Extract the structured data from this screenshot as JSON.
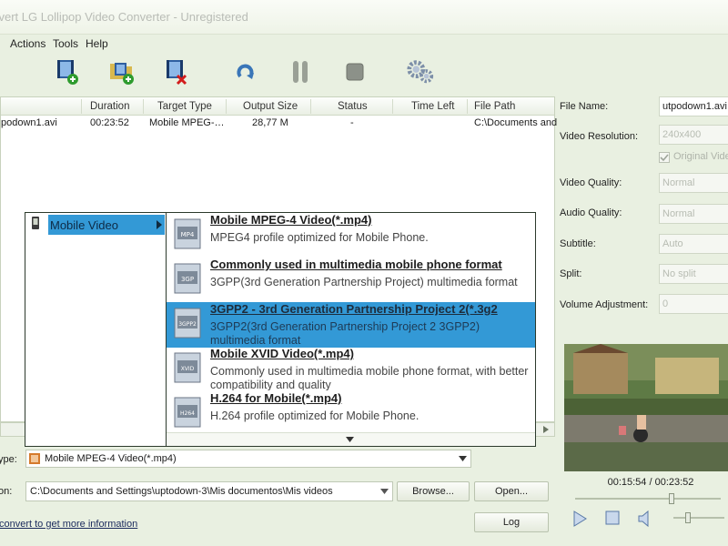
{
  "window": {
    "title": "onvert LG Lollipop Video Converter - Unregistered"
  },
  "menu": {
    "items": [
      "Actions",
      "Tools",
      "Help"
    ]
  },
  "toolbar": {
    "icons": [
      "add-video-icon",
      "add-folder-icon",
      "remove-video-icon",
      "refresh-icon",
      "pause-icon",
      "stop-icon",
      "settings-gears-icon"
    ]
  },
  "file_list": {
    "columns": [
      "Duration",
      "Target Type",
      "Output Size",
      "Status",
      "Time Left",
      "File Path"
    ],
    "rows": [
      {
        "name": "podown1.avi",
        "duration": "00:23:52",
        "target_type": "Mobile MPEG-…",
        "output_size": "28,77 M",
        "status": "-",
        "time_left": "",
        "file_path": "C:\\Documents and"
      }
    ]
  },
  "category_menu": {
    "label": "Mobile Video"
  },
  "formats": [
    {
      "icon": "mp4-file-icon",
      "title": "Mobile MPEG-4 Video(*.mp4)",
      "description": "MPEG4 profile optimized for Mobile Phone.",
      "selected": false
    },
    {
      "icon": "3gp-file-icon",
      "title": "Commonly used in multimedia mobile phone format",
      "description": "3GPP(3rd Generation Partnership Project) multimedia format",
      "selected": false
    },
    {
      "icon": "3gpp2-file-icon",
      "title": "3GPP2 - 3rd Generation Partnership Project 2(*.3g2",
      "description": "3GPP2(3rd Generation Partnership Project 2 3GPP2) multimedia format",
      "selected": true
    },
    {
      "icon": "xvid-file-icon",
      "title": "Mobile XVID Video(*.mp4)",
      "description": "Commonly used in multimedia mobile phone format, with better compatibility and quality",
      "selected": false
    },
    {
      "icon": "h264-file-icon",
      "title": "H.264 for Mobile(*.mp4)",
      "description": "H.264 profile optimized for Mobile Phone.",
      "selected": false
    }
  ],
  "properties": {
    "file_name_label": "File Name:",
    "file_name": "utpodown1.avi",
    "resolution_label": "Video Resolution:",
    "resolution": "240x400",
    "original_label": "Original Vide",
    "quality_label": "Video Quality:",
    "quality": "Normal",
    "audio_label": "Audio Quality:",
    "audio": "Normal",
    "subtitle_label": "Subtitle:",
    "subtitle": "Auto",
    "split_label": "Split:",
    "split": "No split",
    "volume_label": "Volume Adjustment:",
    "volume": "0"
  },
  "output": {
    "type_label": "ype:",
    "type_value": "Mobile MPEG-4 Video(*.mp4)",
    "path_label": "on:",
    "path_value": "C:\\Documents and Settings\\uptodown-3\\Mis documentos\\Mis videos",
    "browse": "Browse...",
    "open": "Open...",
    "log": "Log",
    "register_link": "convert to get more information"
  },
  "player": {
    "timecode": "00:15:54 / 00:23:52",
    "position": 0.67,
    "volume": 0.25
  },
  "colors": {
    "selection": "#3399d6",
    "background": "#e9f0e1"
  }
}
